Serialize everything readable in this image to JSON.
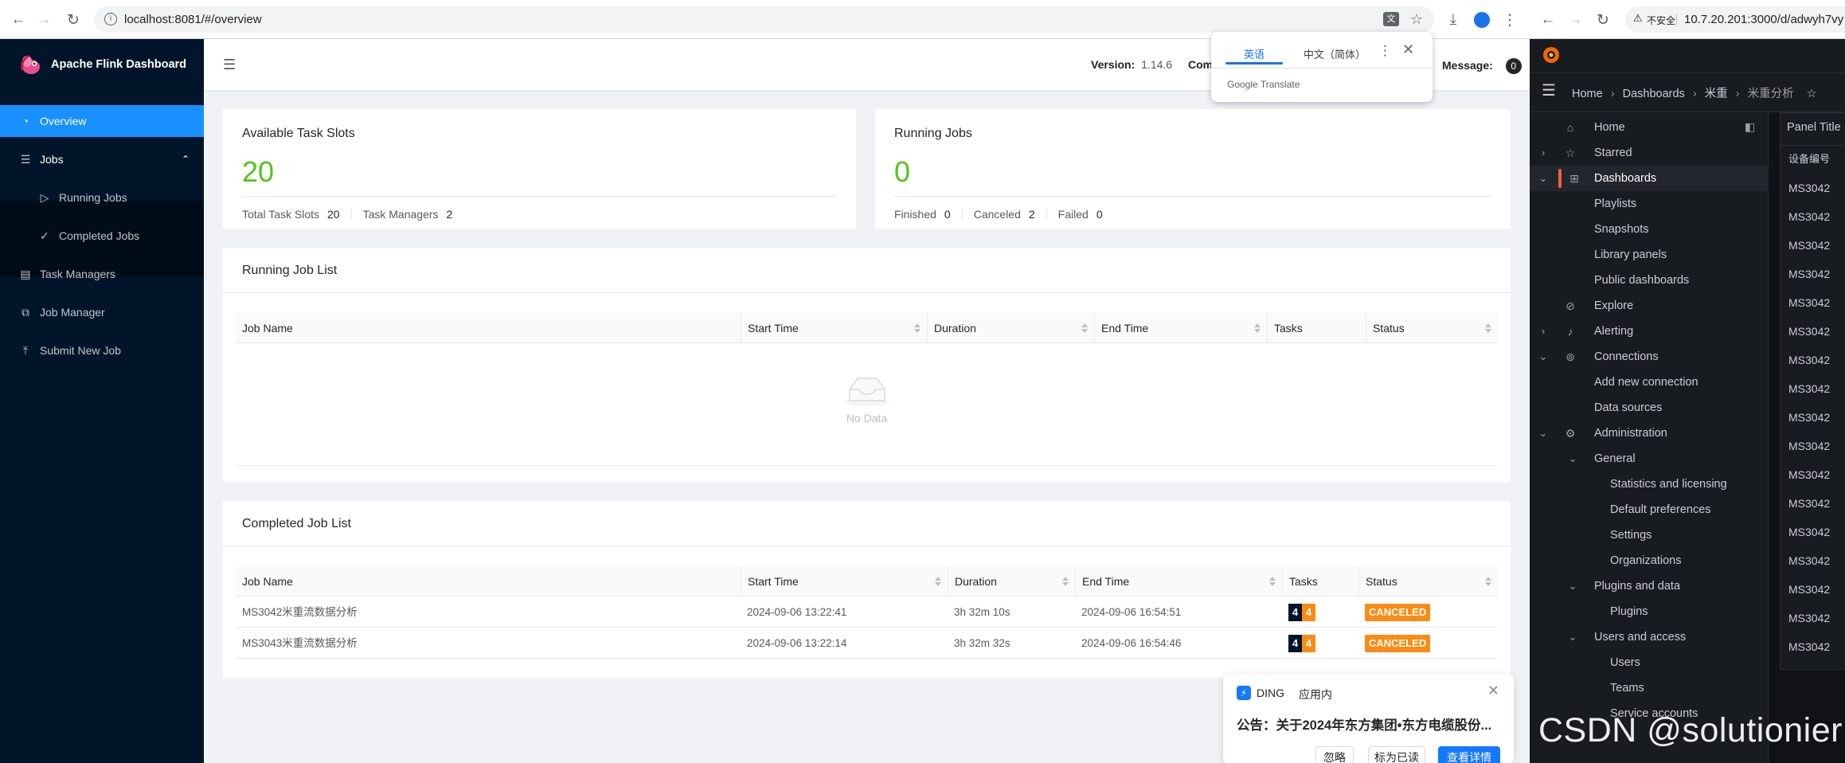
{
  "left_browser": {
    "url": "localhost:8081/#/overview"
  },
  "flink": {
    "app_title": "Apache Flink Dashboard",
    "menu": {
      "overview": "Overview",
      "jobs": "Jobs",
      "running_jobs": "Running Jobs",
      "completed_jobs": "Completed Jobs",
      "task_managers": "Task Managers",
      "job_manager": "Job Manager",
      "submit_new_job": "Submit New Job"
    },
    "header": {
      "version_label": "Version:",
      "version_value": "1.14.6",
      "commit_label": "Comm",
      "message_label": "Message:",
      "message_count": "0"
    },
    "slots_card": {
      "title": "Available Task Slots",
      "value": "20",
      "total_label": "Total Task Slots",
      "total_value": "20",
      "tm_label": "Task Managers",
      "tm_value": "2"
    },
    "running_card": {
      "title": "Running Jobs",
      "value": "0",
      "finished_label": "Finished",
      "finished_value": "0",
      "canceled_label": "Canceled",
      "canceled_value": "2",
      "failed_label": "Failed",
      "failed_value": "0"
    },
    "running_list": {
      "title": "Running Job List",
      "columns": [
        "Job Name",
        "Start Time",
        "Duration",
        "End Time",
        "Tasks",
        "Status"
      ],
      "empty_text": "No Data"
    },
    "completed_list": {
      "title": "Completed Job List",
      "columns": [
        "Job Name",
        "Start Time",
        "Duration",
        "End Time",
        "Tasks",
        "Status"
      ],
      "rows": [
        {
          "name": "MS3042米重流数据分析",
          "start": "2024-09-06 13:22:41",
          "duration": "3h 32m 10s",
          "end": "2024-09-06 16:54:51",
          "tasks_a": "4",
          "tasks_b": "4",
          "status": "CANCELED"
        },
        {
          "name": "MS3043米重流数据分析",
          "start": "2024-09-06 13:22:14",
          "duration": "3h 32m 32s",
          "end": "2024-09-06 16:54:46",
          "tasks_a": "4",
          "tasks_b": "4",
          "status": "CANCELED"
        }
      ]
    }
  },
  "translate_popup": {
    "tab_en": "英语",
    "tab_zh": "中文（简体）",
    "brand": "Google Translate"
  },
  "ding_popup": {
    "app": "DING",
    "scope": "应用内",
    "message": "公告：关于2024年东方集团•东方电缆股份...",
    "btn_ignore": "忽略",
    "btn_mark_read": "标为已读",
    "btn_view": "查看详情"
  },
  "right_browser": {
    "insecure_label": "不安全",
    "url": "10.7.20.201:3000/d/adwyh7vy"
  },
  "grafana": {
    "breadcrumb": [
      "Home",
      "Dashboards",
      "米重",
      "米重分析"
    ],
    "nav": {
      "home": "Home",
      "starred": "Starred",
      "dashboards": "Dashboards",
      "playlists": "Playlists",
      "snapshots": "Snapshots",
      "library_panels": "Library panels",
      "public_dashboards": "Public dashboards",
      "explore": "Explore",
      "alerting": "Alerting",
      "connections": "Connections",
      "add_new_connection": "Add new connection",
      "data_sources": "Data sources",
      "administration": "Administration",
      "general": "General",
      "stats_licensing": "Statistics and licensing",
      "default_preferences": "Default preferences",
      "settings": "Settings",
      "organizations": "Organizations",
      "plugins_and_data": "Plugins and data",
      "plugins": "Plugins",
      "users_and_access": "Users and access",
      "users": "Users",
      "teams": "Teams",
      "service_accounts": "Service accounts"
    },
    "panel": {
      "title": "Panel Title",
      "column_header": "设备编号",
      "cells": [
        "MS3042",
        "MS3042",
        "MS3042",
        "MS3042",
        "MS3042",
        "MS3042",
        "MS3042",
        "MS3042",
        "MS3042",
        "MS3042",
        "MS3042",
        "MS3042",
        "MS3042",
        "MS3042",
        "MS3042",
        "MS3042",
        "MS3042"
      ]
    }
  },
  "watermark": "CSDN @solutionier"
}
